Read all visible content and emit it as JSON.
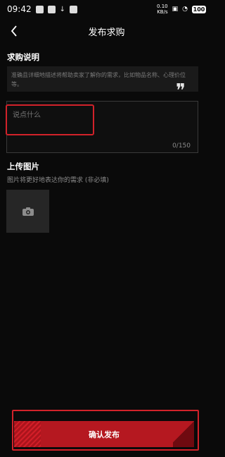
{
  "status_bar": {
    "time": "09:42",
    "speed_top": "0.10",
    "speed_bottom": "KB/s",
    "battery": "100"
  },
  "header": {
    "title": "发布求购"
  },
  "request": {
    "section_title": "求购说明",
    "hint": "准确且详细地描述将帮助卖家了解你的需求，比如物品名称、心理价位等。",
    "textarea_placeholder": "说点什么",
    "char_count": "0/150"
  },
  "upload": {
    "title": "上传图片",
    "subtitle": "图片将更好地表达你的需求 (非必填)"
  },
  "footer": {
    "publish_label": "确认发布"
  },
  "colors": {
    "background": "#0a0a0a",
    "accent_red": "#b51820",
    "highlight_red": "#d2222a"
  }
}
